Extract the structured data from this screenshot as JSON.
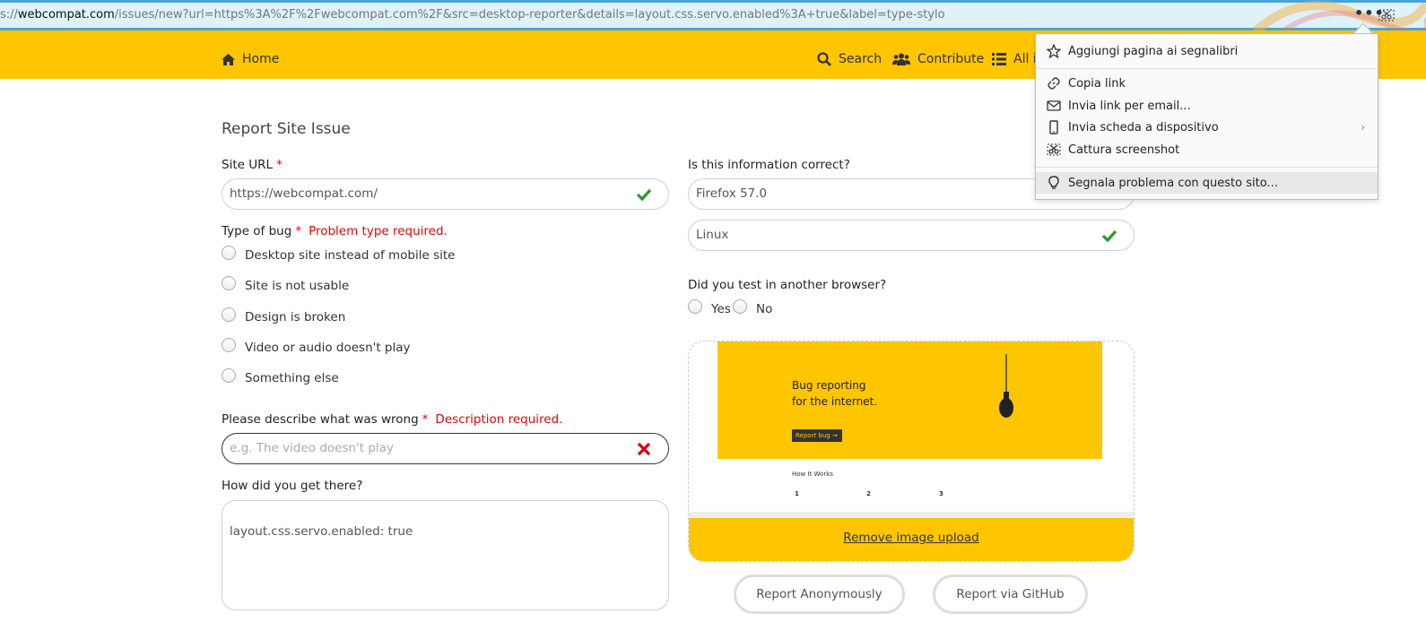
{
  "browser": {
    "url_prefix": "s://",
    "url_domain": "webcompat.com",
    "url_rest": "/issues/new?url=https%3A%2F%2Fwebcompat.com%2F&src=desktop-reporter&details=layout.css.servo.enabled%3A+true&label=type-stylo",
    "more_label": "•••"
  },
  "nav": {
    "home": "Home",
    "search": "Search",
    "contribute": "Contribute",
    "issues": "All i"
  },
  "form": {
    "title": "Report Site Issue",
    "site_url_label": "Site URL",
    "required_mark": "*",
    "site_url_value": "https://webcompat.com/",
    "info_label": "Is this information correct?",
    "browser_value": "Firefox 57.0",
    "os_value": "Linux",
    "bug_type_label": "Type of bug",
    "bug_type_error": "Problem type required.",
    "bug_types": [
      "Desktop site instead of mobile site",
      "Site is not usable",
      "Design is broken",
      "Video or audio doesn't play",
      "Something else"
    ],
    "tested_label": "Did you test in another browser?",
    "tested_yes": "Yes",
    "tested_no": "No",
    "describe_label": "Please describe what was wrong",
    "describe_error": "Description required.",
    "describe_placeholder": "e.g. The video doesn't play",
    "steps_label": "How did you get there?",
    "steps_value": "layout.css.servo.enabled: true",
    "remove_upload": "Remove image upload",
    "report_anon": "Report Anonymously",
    "report_github": "Report via GitHub"
  },
  "screenshot": {
    "tagline_1": "Bug reporting",
    "tagline_2": "for the internet.",
    "report_btn": "Report bug",
    "how_title": "How It Works",
    "steps": [
      "1",
      "2",
      "3"
    ]
  },
  "menu": {
    "items": [
      {
        "label": "Aggiungi pagina ai segnalibri",
        "icon": "star-icon"
      },
      {
        "label": "Copia link",
        "icon": "link-icon"
      },
      {
        "label": "Invia link per email...",
        "icon": "mail-icon"
      },
      {
        "label": "Invia scheda a dispositivo",
        "icon": "device-icon"
      },
      {
        "label": "Cattura screenshot",
        "icon": "scissors-icon"
      },
      {
        "label": "Segnala problema con questo sito...",
        "icon": "lightbulb-icon"
      }
    ]
  },
  "colors": {
    "brand_yellow": "#fdc600",
    "error_red": "#e00000",
    "valid_green": "#2a9a2a"
  }
}
